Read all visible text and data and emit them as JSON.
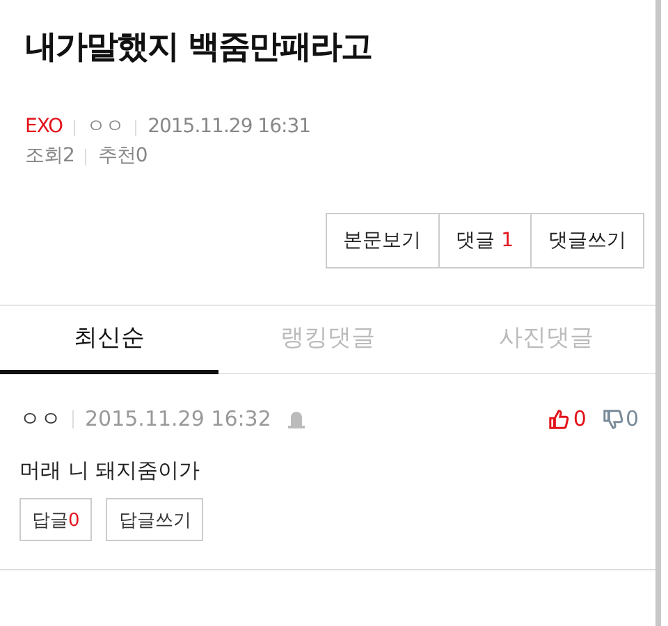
{
  "article": {
    "title": "내가말했지 백줌만패라고",
    "category": "EXO",
    "author": "ㅇㅇ",
    "date": "2015.11.29 16:31",
    "views_label": "조회",
    "views": "2",
    "recommend_label": "추천",
    "recommend": "0"
  },
  "actions": [
    {
      "label": "본문보기"
    },
    {
      "label": "댓글",
      "count": "1"
    },
    {
      "label": "댓글쓰기"
    }
  ],
  "tabs": [
    {
      "label": "최신순",
      "selected": true
    },
    {
      "label": "랭킹댓글",
      "selected": false
    },
    {
      "label": "사진댓글",
      "selected": false
    }
  ],
  "comments": [
    {
      "author": "ㅇㅇ",
      "date": "2015.11.29 16:32",
      "likes": "0",
      "dislikes": "0",
      "text": "머래 니 돼지줌이가",
      "reply_label": "답글",
      "reply_count": "0",
      "write_label": "답글쓰기"
    }
  ]
}
